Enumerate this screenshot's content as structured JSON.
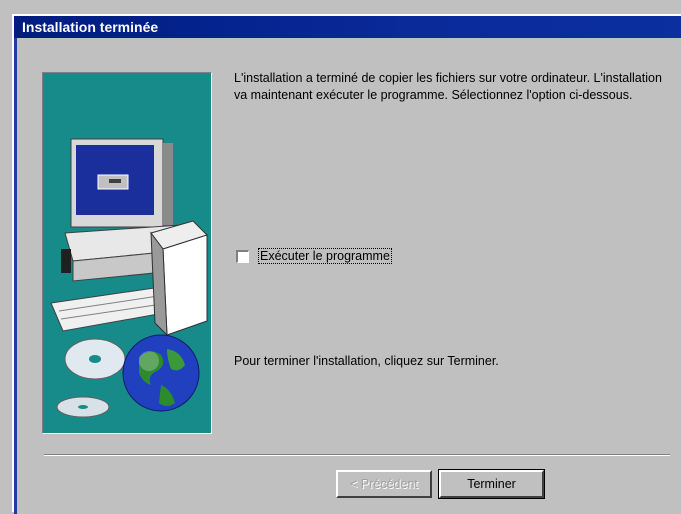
{
  "window": {
    "title": "Installation terminée"
  },
  "content": {
    "intro_text": "L'installation a terminé de copier les fichiers sur votre ordinateur. L'installation va maintenant exécuter le programme. Sélectionnez l'option ci-dessous.",
    "run_program_label": "Exécuter le programme",
    "run_program_checked": false,
    "finish_text": "Pour terminer l'installation, cliquez sur Terminer."
  },
  "buttons": {
    "back_label": "< Précédent",
    "back_enabled": false,
    "finish_label": "Terminer"
  },
  "illustration": {
    "icons": [
      "computer-icon",
      "cd-icon",
      "globe-icon"
    ]
  }
}
